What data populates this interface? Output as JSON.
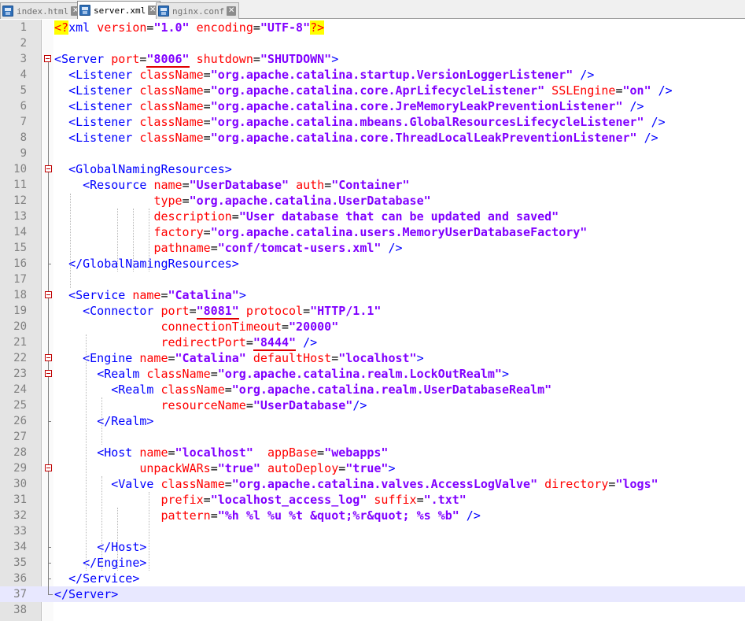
{
  "tabs": [
    {
      "label": "index.html",
      "active": false
    },
    {
      "label": "server.xml",
      "active": true
    },
    {
      "label": "nginx.conf",
      "active": false
    }
  ],
  "editor": {
    "current_line": 37,
    "lines": [
      {
        "n": "1",
        "fold": "none",
        "tokens": [
          [
            "decl",
            "<?"
          ],
          [
            "declname",
            "xml"
          ],
          [
            "sp",
            " "
          ],
          [
            "attr",
            "version"
          ],
          [
            "eq",
            "="
          ],
          [
            "val",
            "\"1.0\""
          ],
          [
            "sp",
            " "
          ],
          [
            "attr",
            "encoding"
          ],
          [
            "eq",
            "="
          ],
          [
            "val",
            "\"UTF-8\""
          ],
          [
            "decl",
            "?>"
          ]
        ]
      },
      {
        "n": "2",
        "fold": "none",
        "tokens": []
      },
      {
        "n": "3",
        "fold": "open-root",
        "tokens": [
          [
            "tag",
            "<Server"
          ],
          [
            "sp",
            " "
          ],
          [
            "attr",
            "port"
          ],
          [
            "eq",
            "="
          ],
          [
            "valu",
            "\"8006\""
          ],
          [
            "sp",
            " "
          ],
          [
            "attr",
            "shutdown"
          ],
          [
            "eq",
            "="
          ],
          [
            "val",
            "\"SHUTDOWN\""
          ],
          [
            "tag",
            ">"
          ]
        ]
      },
      {
        "n": "4",
        "fold": "line",
        "tokens": [
          [
            "sp",
            "  "
          ],
          [
            "tag",
            "<Listener"
          ],
          [
            "sp",
            " "
          ],
          [
            "attr",
            "className"
          ],
          [
            "eq",
            "="
          ],
          [
            "val",
            "\"org.apache.catalina.startup.VersionLoggerListener\""
          ],
          [
            "sp",
            " "
          ],
          [
            "tag",
            "/>"
          ]
        ]
      },
      {
        "n": "5",
        "fold": "line",
        "tokens": [
          [
            "sp",
            "  "
          ],
          [
            "tag",
            "<Listener"
          ],
          [
            "sp",
            " "
          ],
          [
            "attr",
            "className"
          ],
          [
            "eq",
            "="
          ],
          [
            "val",
            "\"org.apache.catalina.core.AprLifecycleListener\""
          ],
          [
            "sp",
            " "
          ],
          [
            "attr",
            "SSLEngine"
          ],
          [
            "eq",
            "="
          ],
          [
            "val",
            "\"on\""
          ],
          [
            "sp",
            " "
          ],
          [
            "tag",
            "/>"
          ]
        ]
      },
      {
        "n": "6",
        "fold": "line",
        "tokens": [
          [
            "sp",
            "  "
          ],
          [
            "tag",
            "<Listener"
          ],
          [
            "sp",
            " "
          ],
          [
            "attr",
            "className"
          ],
          [
            "eq",
            "="
          ],
          [
            "val",
            "\"org.apache.catalina.core.JreMemoryLeakPreventionListener\""
          ],
          [
            "sp",
            " "
          ],
          [
            "tag",
            "/>"
          ]
        ]
      },
      {
        "n": "7",
        "fold": "line",
        "tokens": [
          [
            "sp",
            "  "
          ],
          [
            "tag",
            "<Listener"
          ],
          [
            "sp",
            " "
          ],
          [
            "attr",
            "className"
          ],
          [
            "eq",
            "="
          ],
          [
            "val",
            "\"org.apache.catalina.mbeans.GlobalResourcesLifecycleListener\""
          ],
          [
            "sp",
            " "
          ],
          [
            "tag",
            "/>"
          ]
        ]
      },
      {
        "n": "8",
        "fold": "line",
        "tokens": [
          [
            "sp",
            "  "
          ],
          [
            "tag",
            "<Listener"
          ],
          [
            "sp",
            " "
          ],
          [
            "attr",
            "className"
          ],
          [
            "eq",
            "="
          ],
          [
            "val",
            "\"org.apache.catalina.core.ThreadLocalLeakPreventionListener\""
          ],
          [
            "sp",
            " "
          ],
          [
            "tag",
            "/>"
          ]
        ]
      },
      {
        "n": "9",
        "fold": "line",
        "tokens": []
      },
      {
        "n": "10",
        "fold": "open",
        "tokens": [
          [
            "sp",
            "  "
          ],
          [
            "tag",
            "<GlobalNamingResources>"
          ]
        ]
      },
      {
        "n": "11",
        "fold": "line",
        "tokens": [
          [
            "sp",
            "    "
          ],
          [
            "tag",
            "<Resource"
          ],
          [
            "sp",
            " "
          ],
          [
            "attr",
            "name"
          ],
          [
            "eq",
            "="
          ],
          [
            "val",
            "\"UserDatabase\""
          ],
          [
            "sp",
            " "
          ],
          [
            "attr",
            "auth"
          ],
          [
            "eq",
            "="
          ],
          [
            "val",
            "\"Container\""
          ]
        ]
      },
      {
        "n": "12",
        "fold": "line",
        "tokens": [
          [
            "sp",
            "              "
          ],
          [
            "attr",
            "type"
          ],
          [
            "eq",
            "="
          ],
          [
            "val",
            "\"org.apache.catalina.UserDatabase\""
          ]
        ]
      },
      {
        "n": "13",
        "fold": "line",
        "tokens": [
          [
            "sp",
            "              "
          ],
          [
            "attr",
            "description"
          ],
          [
            "eq",
            "="
          ],
          [
            "val",
            "\"User database that can be updated and saved\""
          ]
        ]
      },
      {
        "n": "14",
        "fold": "line",
        "tokens": [
          [
            "sp",
            "              "
          ],
          [
            "attr",
            "factory"
          ],
          [
            "eq",
            "="
          ],
          [
            "val",
            "\"org.apache.catalina.users.MemoryUserDatabaseFactory\""
          ]
        ]
      },
      {
        "n": "15",
        "fold": "line",
        "tokens": [
          [
            "sp",
            "              "
          ],
          [
            "attr",
            "pathname"
          ],
          [
            "eq",
            "="
          ],
          [
            "val",
            "\"conf/tomcat-users.xml\""
          ],
          [
            "sp",
            " "
          ],
          [
            "tag",
            "/>"
          ]
        ]
      },
      {
        "n": "16",
        "fold": "end",
        "tokens": [
          [
            "sp",
            "  "
          ],
          [
            "tag",
            "</GlobalNamingResources>"
          ]
        ]
      },
      {
        "n": "17",
        "fold": "line",
        "tokens": []
      },
      {
        "n": "18",
        "fold": "open",
        "tokens": [
          [
            "sp",
            "  "
          ],
          [
            "tag",
            "<Service"
          ],
          [
            "sp",
            " "
          ],
          [
            "attr",
            "name"
          ],
          [
            "eq",
            "="
          ],
          [
            "val",
            "\"Catalina\""
          ],
          [
            "tag",
            ">"
          ]
        ]
      },
      {
        "n": "19",
        "fold": "line",
        "tokens": [
          [
            "sp",
            "    "
          ],
          [
            "tag",
            "<Connector"
          ],
          [
            "sp",
            " "
          ],
          [
            "attr",
            "port"
          ],
          [
            "eq",
            "="
          ],
          [
            "valu",
            "\"8081\""
          ],
          [
            "sp",
            " "
          ],
          [
            "attr",
            "protocol"
          ],
          [
            "eq",
            "="
          ],
          [
            "val",
            "\"HTTP/1.1\""
          ]
        ]
      },
      {
        "n": "20",
        "fold": "line",
        "tokens": [
          [
            "sp",
            "               "
          ],
          [
            "attr",
            "connectionTimeout"
          ],
          [
            "eq",
            "="
          ],
          [
            "val",
            "\"20000\""
          ]
        ]
      },
      {
        "n": "21",
        "fold": "line",
        "tokens": [
          [
            "sp",
            "               "
          ],
          [
            "attr",
            "redirectPort"
          ],
          [
            "eq",
            "="
          ],
          [
            "valu",
            "\"8444\""
          ],
          [
            "sp",
            " "
          ],
          [
            "tag",
            "/>"
          ]
        ]
      },
      {
        "n": "22",
        "fold": "open",
        "tokens": [
          [
            "sp",
            "    "
          ],
          [
            "tag",
            "<Engine"
          ],
          [
            "sp",
            " "
          ],
          [
            "attr",
            "name"
          ],
          [
            "eq",
            "="
          ],
          [
            "val",
            "\"Catalina\""
          ],
          [
            "sp",
            " "
          ],
          [
            "attr",
            "defaultHost"
          ],
          [
            "eq",
            "="
          ],
          [
            "val",
            "\"localhost\""
          ],
          [
            "tag",
            ">"
          ]
        ]
      },
      {
        "n": "23",
        "fold": "open",
        "tokens": [
          [
            "sp",
            "      "
          ],
          [
            "tag",
            "<Realm"
          ],
          [
            "sp",
            " "
          ],
          [
            "attr",
            "className"
          ],
          [
            "eq",
            "="
          ],
          [
            "val",
            "\"org.apache.catalina.realm.LockOutRealm\""
          ],
          [
            "tag",
            ">"
          ]
        ]
      },
      {
        "n": "24",
        "fold": "line",
        "tokens": [
          [
            "sp",
            "        "
          ],
          [
            "tag",
            "<Realm"
          ],
          [
            "sp",
            " "
          ],
          [
            "attr",
            "className"
          ],
          [
            "eq",
            "="
          ],
          [
            "val",
            "\"org.apache.catalina.realm.UserDatabaseRealm\""
          ]
        ]
      },
      {
        "n": "25",
        "fold": "line",
        "tokens": [
          [
            "sp",
            "               "
          ],
          [
            "attr",
            "resourceName"
          ],
          [
            "eq",
            "="
          ],
          [
            "val",
            "\"UserDatabase\""
          ],
          [
            "tag",
            "/>"
          ]
        ]
      },
      {
        "n": "26",
        "fold": "end",
        "tokens": [
          [
            "sp",
            "      "
          ],
          [
            "tag",
            "</Realm>"
          ]
        ]
      },
      {
        "n": "27",
        "fold": "line",
        "tokens": []
      },
      {
        "n": "28",
        "fold": "line",
        "tokens": [
          [
            "sp",
            "      "
          ],
          [
            "tag",
            "<Host"
          ],
          [
            "sp",
            " "
          ],
          [
            "attr",
            "name"
          ],
          [
            "eq",
            "="
          ],
          [
            "val",
            "\"localhost\""
          ],
          [
            "sp",
            "  "
          ],
          [
            "attr",
            "appBase"
          ],
          [
            "eq",
            "="
          ],
          [
            "val",
            "\"webapps\""
          ]
        ]
      },
      {
        "n": "29",
        "fold": "open",
        "tokens": [
          [
            "sp",
            "            "
          ],
          [
            "attr",
            "unpackWARs"
          ],
          [
            "eq",
            "="
          ],
          [
            "val",
            "\"true\""
          ],
          [
            "sp",
            " "
          ],
          [
            "attr",
            "autoDeploy"
          ],
          [
            "eq",
            "="
          ],
          [
            "val",
            "\"true\""
          ],
          [
            "tag",
            ">"
          ]
        ]
      },
      {
        "n": "30",
        "fold": "line",
        "tokens": [
          [
            "sp",
            "        "
          ],
          [
            "tag",
            "<Valve"
          ],
          [
            "sp",
            " "
          ],
          [
            "attr",
            "className"
          ],
          [
            "eq",
            "="
          ],
          [
            "val",
            "\"org.apache.catalina.valves.AccessLogValve\""
          ],
          [
            "sp",
            " "
          ],
          [
            "attr",
            "directory"
          ],
          [
            "eq",
            "="
          ],
          [
            "val",
            "\"logs\""
          ]
        ]
      },
      {
        "n": "31",
        "fold": "line",
        "tokens": [
          [
            "sp",
            "               "
          ],
          [
            "attr",
            "prefix"
          ],
          [
            "eq",
            "="
          ],
          [
            "val",
            "\"localhost_access_log\""
          ],
          [
            "sp",
            " "
          ],
          [
            "attr",
            "suffix"
          ],
          [
            "eq",
            "="
          ],
          [
            "val",
            "\".txt\""
          ]
        ]
      },
      {
        "n": "32",
        "fold": "line",
        "tokens": [
          [
            "sp",
            "               "
          ],
          [
            "attr",
            "pattern"
          ],
          [
            "eq",
            "="
          ],
          [
            "val",
            "\"%h %l %u %t &quot;%r&quot; %s %b\""
          ],
          [
            "sp",
            " "
          ],
          [
            "tag",
            "/>"
          ]
        ]
      },
      {
        "n": "33",
        "fold": "line",
        "tokens": []
      },
      {
        "n": "34",
        "fold": "end",
        "tokens": [
          [
            "sp",
            "      "
          ],
          [
            "tag",
            "</Host>"
          ]
        ]
      },
      {
        "n": "35",
        "fold": "end",
        "tokens": [
          [
            "sp",
            "    "
          ],
          [
            "tag",
            "</Engine>"
          ]
        ]
      },
      {
        "n": "36",
        "fold": "end",
        "tokens": [
          [
            "sp",
            "  "
          ],
          [
            "tag",
            "</Service>"
          ]
        ]
      },
      {
        "n": "37",
        "fold": "end-root",
        "tokens": [
          [
            "tag",
            "</Server>"
          ]
        ]
      },
      {
        "n": "38",
        "fold": "none",
        "tokens": []
      }
    ]
  },
  "colors": {
    "tag": "#0000ff",
    "attr": "#ff0000",
    "value": "#8000ff",
    "decl_bg": "#ffff00",
    "underline": "#e00000",
    "current_line": "#e8e8ff"
  },
  "icons": {
    "tab_file": "floppy-disk-icon",
    "tab_close": "close-icon",
    "fold_open": "fold-minus-icon"
  }
}
